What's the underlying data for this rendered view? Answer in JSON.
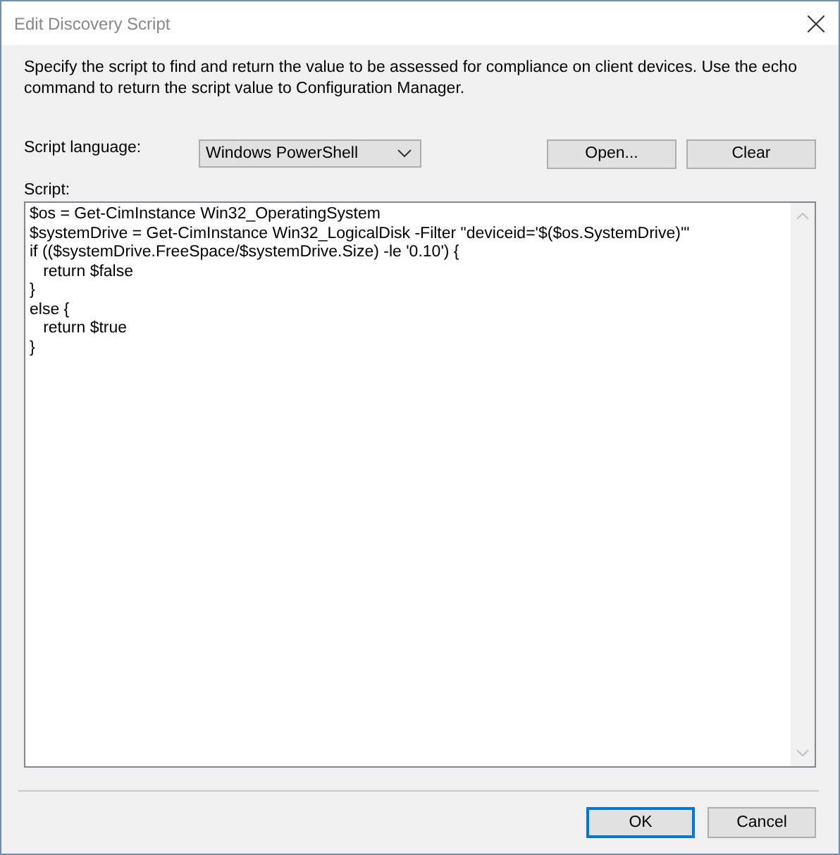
{
  "window": {
    "title": "Edit Discovery Script"
  },
  "description": "Specify the script to find and return the value to be assessed for compliance on client devices. Use the echo command to return the script value to Configuration Manager.",
  "script_language": {
    "label": "Script language:",
    "value": "Windows PowerShell"
  },
  "toolbar_buttons": [
    {
      "label": "Open..."
    },
    {
      "label": "Clear"
    }
  ],
  "script": {
    "label": "Script:",
    "lines": [
      "$os = Get-CimInstance Win32_OperatingSystem",
      "$systemDrive = Get-CimInstance Win32_LogicalDisk -Filter \"deviceid='$($os.SystemDrive)'\"",
      "if (($systemDrive.FreeSpace/$systemDrive.Size) -le '0.10') {",
      "   return $false",
      "}",
      "else {",
      "   return $true",
      "}"
    ]
  },
  "buttons": [
    {
      "label": "OK",
      "default": true
    },
    {
      "label": "Cancel",
      "default": false
    }
  ]
}
